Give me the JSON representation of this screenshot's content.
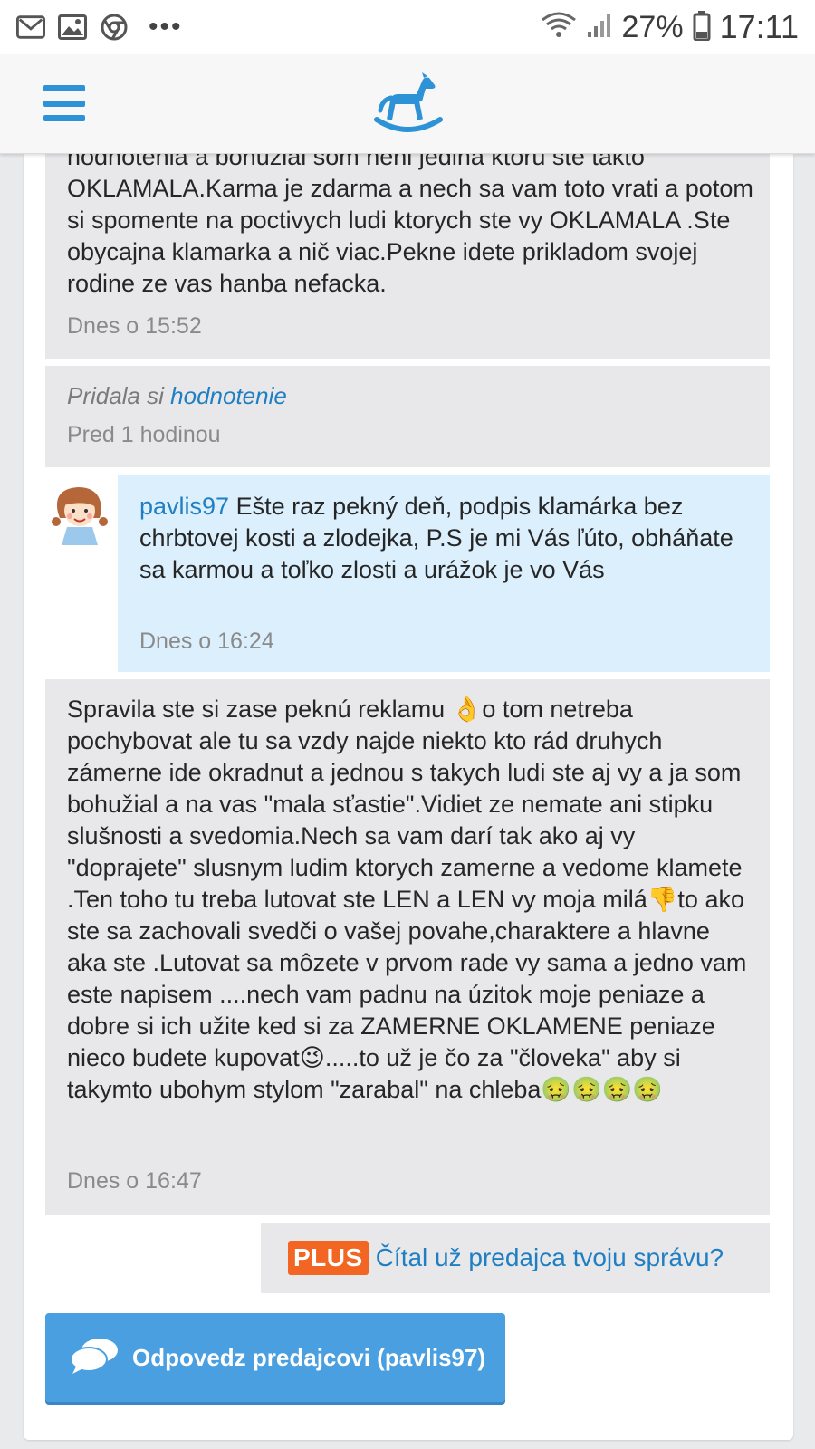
{
  "status_bar": {
    "battery": "27%",
    "time": "17:11",
    "icons": [
      "gmail-icon",
      "gallery-icon",
      "chrome-icon",
      "more-dots-icon",
      "wifi-icon",
      "signal-icon",
      "battery-icon"
    ],
    "more_dots": "•••"
  },
  "app": {
    "accent_color": "#2e93d6",
    "logo": "rocking-horse-icon"
  },
  "messages": [
    {
      "text": "hodnotenia a bohužial som neni jedina ktoru ste takto OKLAMALA.Karma je zdarma a nech sa vam toto vrati a potom si spomente na poctivych ludi ktorych ste vy OKLAMALA .Ste obycajna klamarka a nič viac.Pekne idete prikladom svojej rodine ze vas hanba nefacka.",
      "time": "Dnes o 15:52"
    },
    {
      "action_prefix": "Pridala si ",
      "action_link": "hodnotenie",
      "time": "Pred 1 hodinou"
    },
    {
      "user": "pavlis97",
      "text": " Ešte raz pekný deň, podpis klamárka bez chrbtovej kosti a zlodejka, P.S je mi Vás ľúto, obháňate sa karmou a toľko zlosti a urážok je vo Vás",
      "time": "Dnes o 16:24"
    },
    {
      "text": "Spravila ste si zase peknú reklamu 👌o tom netreba pochybovat ale tu sa vzdy najde niekto kto rád druhych zámerne ide okradnut a jednou s takych ludi ste aj vy a ja som bohužial a na vas \"mala sťastie\".Vidiet ze nemate ani stipku slušnosti a svedomia.Nech sa vam darí tak ako aj vy \"doprajete\" slusnym ludim ktorych zamerne a vedome klamete .Ten toho tu treba lutovat ste LEN a LEN vy moja milá👎to ako ste sa zachovali svedči o vašej povahe,charaktere a hlavne aka ste .Lutovat sa môzete v prvom rade vy sama a jedno vam este napisem ....nech vam padnu na úzitok moje peniaze a dobre si ich užite ked si za ZAMERNE OKLAMENE peniaze nieco budete kupovat😉.....to už je čo za \"človeka\" aby si takymto ubohym stylom \"zarabal\" na chleba🤢🤢🤢🤢",
      "time": "Dnes o 16:47"
    }
  ],
  "plus_prompt": {
    "badge": "PLUS",
    "text": "Čítal už predajca tvoju správu?"
  },
  "reply_button": {
    "label": "Odpovedz predajcovi (pavlis97)",
    "icon": "speech-bubbles-icon"
  }
}
